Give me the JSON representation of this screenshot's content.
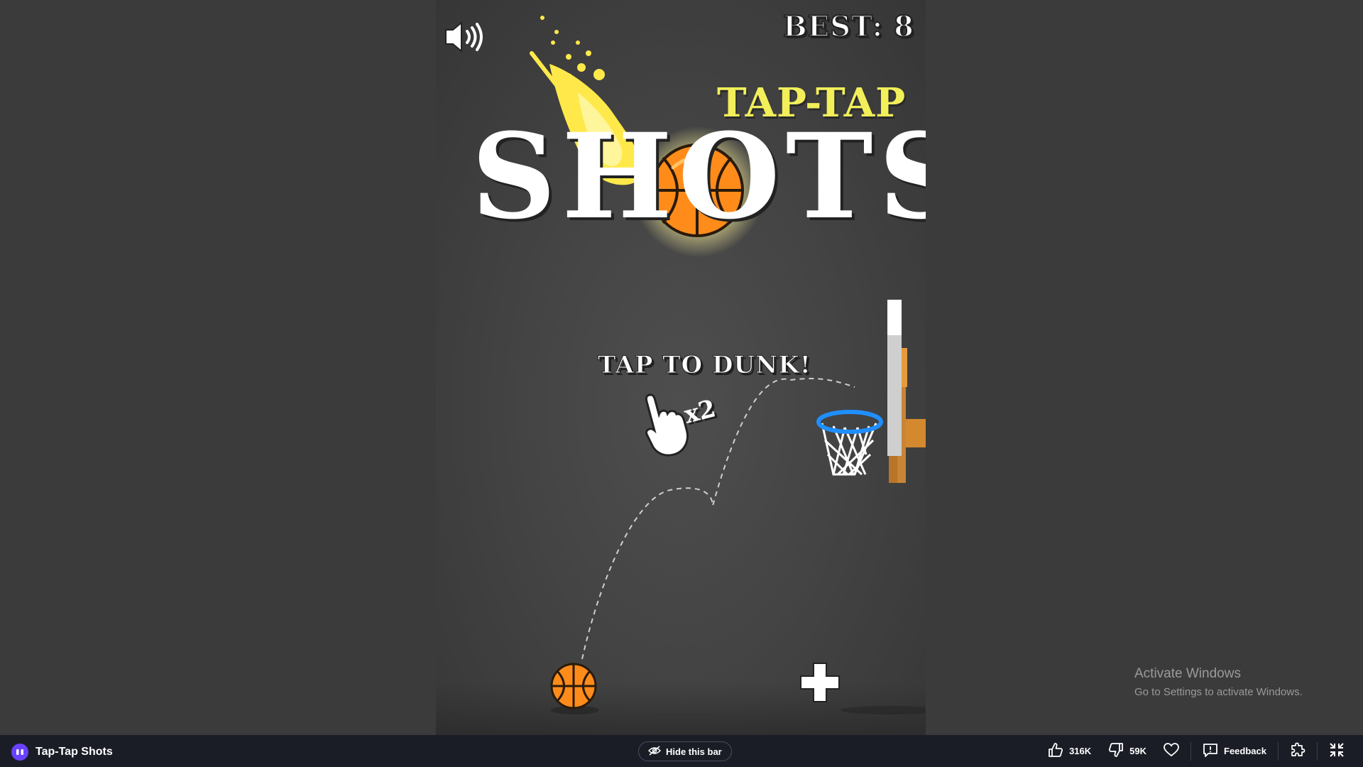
{
  "game": {
    "best_label": "BEST: 8",
    "title_small": "TAP-TAP",
    "title_big": "SHOTS",
    "instruction": "TAP TO DUNK!",
    "multiplier": "x2",
    "colors": {
      "ball": "#ff8c1a",
      "title_small": "#f2ef5a",
      "rim": "#1f8fff",
      "backboard_post": "#d4892e"
    }
  },
  "watermark": {
    "line1": "Activate Windows",
    "line2": "Go to Settings to activate Windows."
  },
  "bottom_bar": {
    "game_title": "Tap-Tap Shots",
    "hide_bar_label": "Hide this bar",
    "like_count": "316K",
    "dislike_count": "59K",
    "feedback_label": "Feedback",
    "icons": [
      "poki-logo-icon",
      "eye-off-icon",
      "thumbs-up-icon",
      "thumbs-down-icon",
      "heart-icon",
      "feedback-icon",
      "puzzle-icon",
      "fullscreen-exit-icon"
    ]
  }
}
